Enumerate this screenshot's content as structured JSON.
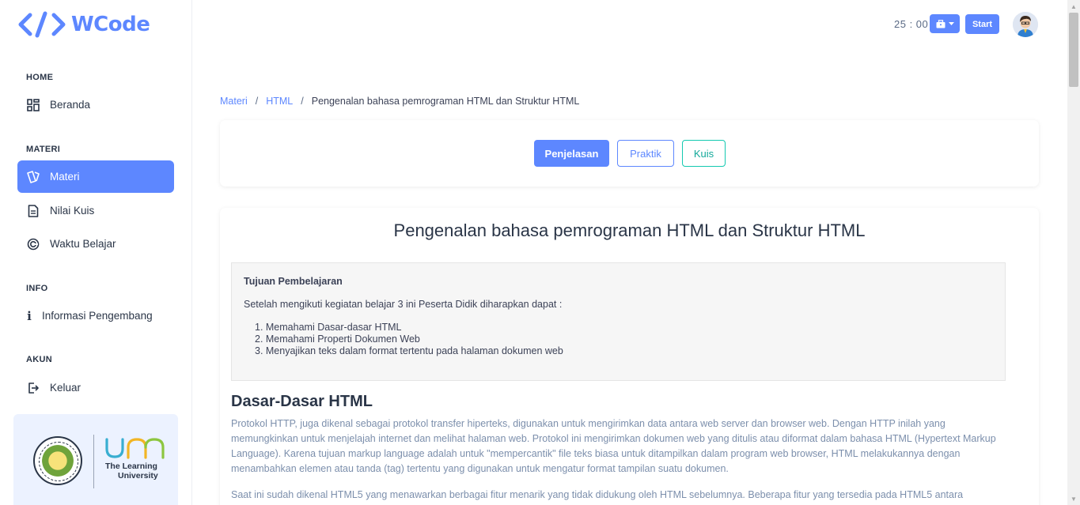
{
  "app": {
    "name": "WCode"
  },
  "sidebar": {
    "sections": [
      {
        "title": "HOME",
        "items": [
          {
            "label": "Beranda",
            "icon": "dashboard-icon"
          }
        ]
      },
      {
        "title": "MATERI",
        "items": [
          {
            "label": "Materi",
            "icon": "cards-icon",
            "active": true
          },
          {
            "label": "Nilai Kuis",
            "icon": "document-icon"
          },
          {
            "label": "Waktu Belajar",
            "icon": "clock-icon"
          }
        ]
      },
      {
        "title": "INFO",
        "items": [
          {
            "label": "Informasi Pengembang",
            "icon": "info-icon"
          }
        ]
      },
      {
        "title": "AKUN",
        "items": [
          {
            "label": "Keluar",
            "icon": "logout-icon"
          }
        ]
      }
    ],
    "university": {
      "tagline_1": "The Learning",
      "tagline_2": "University"
    }
  },
  "topbar": {
    "timer": "25 : 00",
    "start_label": "Start"
  },
  "breadcrumb": {
    "items": [
      "Materi",
      "HTML"
    ],
    "current": "Pengenalan bahasa pemrograman HTML dan Struktur HTML"
  },
  "tabs": [
    "Penjelasan",
    "Praktik",
    "Kuis"
  ],
  "content": {
    "title": "Pengenalan bahasa pemrograman HTML dan Struktur HTML",
    "objective_heading": "Tujuan Pembelajaran",
    "objective_intro": "Setelah mengikuti kegiatan belajar 3 ini Peserta Didik diharapkan dapat :",
    "objectives": [
      "1. Memahami Dasar-dasar HTML",
      "2. Memahami Properti Dokumen Web",
      "3. Menyajikan teks dalam format tertentu pada halaman dokumen web"
    ],
    "section_title": "Dasar-Dasar HTML",
    "paragraph_1": "Protokol HTTP, juga dikenal sebagai protokol transfer hiperteks, digunakan untuk mengirimkan data antara web server dan browser web. Dengan HTTP inilah yang memungkinkan untuk menjelajah internet dan melihat halaman web. Protokol ini mengirimkan dokumen web yang ditulis atau diformat dalam bahasa HTML (Hypertext Markup Language). Karena tujuan markup language adalah untuk \"mempercantik\" file teks biasa untuk ditampilkan dalam program web browser, HTML melakukannya dengan menambahkan elemen atau tanda (tag) tertentu yang digunakan untuk mengatur format tampilan suatu dokumen.",
    "paragraph_2": "Saat ini sudah dikenal HTML5 yang menawarkan berbagai fitur menarik yang tidak didukung oleh HTML sebelumnya. Beberapa fitur yang tersedia pada HTML5 antara"
  },
  "colors": {
    "primary": "#5d87ff",
    "teal": "#13c9b0",
    "text": "#2a3547",
    "muted": "#7c8fac"
  }
}
